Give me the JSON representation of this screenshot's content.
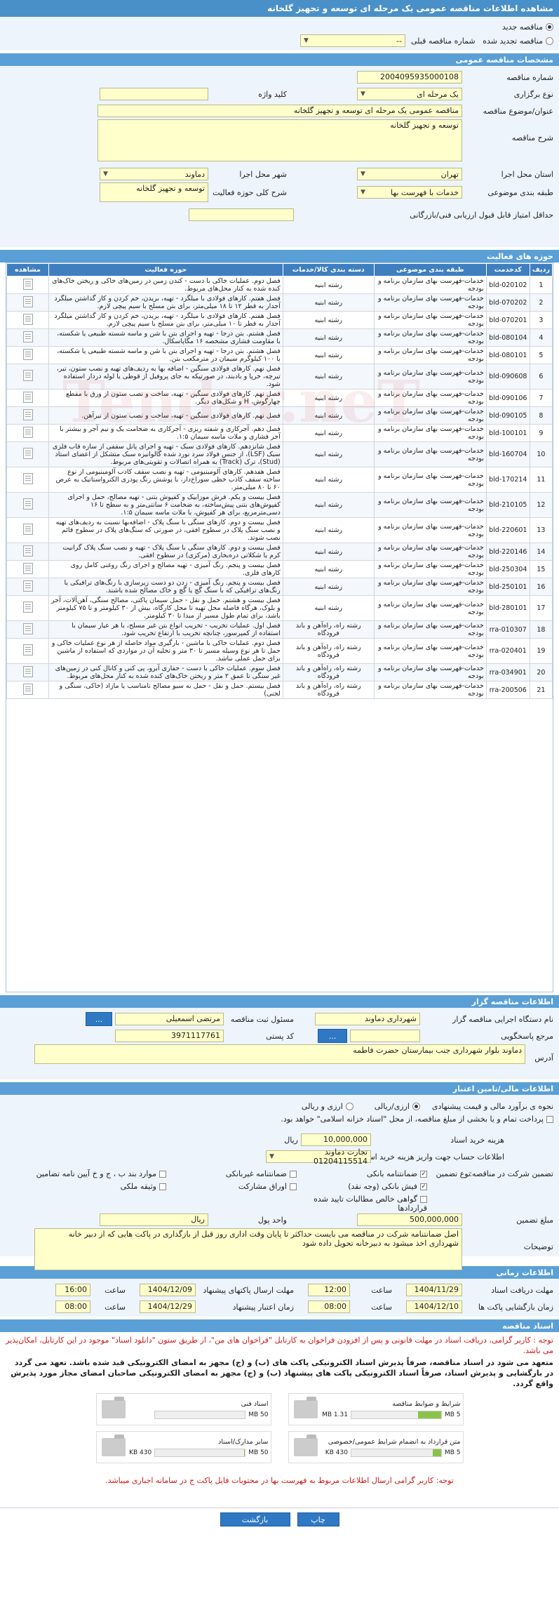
{
  "page_title": "مشاهده اطلاعات مناقصه عمومی یک مرحله ای توسعه و تجهیز گلخانه",
  "tender_type": {
    "new_label": "مناقصه جدید",
    "renew_label": "مناقصه تجدید شده",
    "prev_number_label": "شماره مناقصه قبلی",
    "prev_number_value": "--"
  },
  "specs": {
    "header": "مشخصات مناقصه عمومی",
    "number_label": "شماره مناقصه",
    "number_value": "2004095935000108",
    "hold_type_label": "نوع برگزاری",
    "hold_type_value": "یک مرحله ای",
    "keyword_label": "کلید واژه",
    "keyword_value": "",
    "subject_label": "عنوان/موضوع مناقصه",
    "subject_value": "مناقصه عمومی یک مرحله ای توسعه و تجهیز گلخانه",
    "description_label": "شرح مناقصه",
    "description_value": "توسعه و تجهیز گلخانه",
    "province_label": "استان محل اجرا",
    "province_value": "تهران",
    "city_label": "شهر محل اجرا",
    "city_value": "دماوند",
    "category_label": "طبقه بندی موضوعی",
    "category_value": "خدمات با فهرست بها",
    "activity_label": "شرح کلی حوزه فعالیت",
    "activity_value": "توسعه و تجهیز گلخانه",
    "min_score_label": "حداقل امتیاز قابل قبول ارزیابی فنی/بازرگانی",
    "min_score_value": ""
  },
  "activity_table": {
    "header": "حوزه های فعالیت",
    "columns": [
      "ردیف",
      "کدخدمت",
      "طبقه بندی موضوعی",
      "دسته بندی کالا/خدمات",
      "حوزه فعالیت",
      "مشاهده"
    ],
    "rows": [
      {
        "n": "1",
        "code": "bld-020102",
        "cat": "خدمات-فهرست بهای سازمان برنامه و بودجه",
        "group": "رشته ابنیه",
        "desc": "فصل دوم. عملیات خاکی با دست - کندن زمین در زمین‌های خاکی و ریختن خاک‌های کنده شده به کنار محل‌های مربوط."
      },
      {
        "n": "2",
        "code": "bld-070202",
        "cat": "خدمات-فهرست بهای سازمان برنامه و بودجه",
        "group": "رشته ابنیه",
        "desc": "فصل هفتم. کارهای فولادی با میلگرد - تهیه، بریدن، خم کردن و کار گذاشتن میلگرد آجدار به قطر ۱۲ تا ۱۸ میلی‌متر، برای بتن مسلح با سیم پیچی لازم."
      },
      {
        "n": "3",
        "code": "bld-070201",
        "cat": "خدمات-فهرست بهای سازمان برنامه و بودجه",
        "group": "رشته ابنیه",
        "desc": "فصل هفتم. کارهای فولادی با میلگرد - تهیه، بریدن، خم کردن و کار گذاشتن میلگرد آجدار به قطر تا ۱۰ میلی‌متر، برای بتن مسلح با سیم پیچی لازم."
      },
      {
        "n": "4",
        "code": "bld-080104",
        "cat": "خدمات-فهرست بهای سازمان برنامه و بودجه",
        "group": "رشته ابنیه",
        "desc": "فصل هشتم. بتن درجا - تهیه و اجرای بتن با شن و ماسه شسته طبیعی یا شکسته، با مقاومت فشاری مشخصه ۱۶ مگاپاسکال."
      },
      {
        "n": "5",
        "code": "bld-080101",
        "cat": "خدمات-فهرست بهای سازمان برنامه و بودجه",
        "group": "رشته ابنیه",
        "desc": "فصل هشتم. بتن درجا - تهیه و اجرای بتن با شن و ماسه شسته طبیعی یا شکسته، با ۱۰۰ کیلوگرم سیمان در مترمکعب بتن."
      },
      {
        "n": "6",
        "code": "bld-090608",
        "cat": "خدمات-فهرست بهای سازمان برنامه و بودجه",
        "group": "رشته ابنیه",
        "desc": "فصل نهم. کارهای فولادی سنگین - اضافه بها به ردیف‌های تهیه و نصب ستون، تیر، تیرچه، خرپا و بادبند، در صورتیکه به جای پروفیل از قوطی یا لوله دردار استفاده شود."
      },
      {
        "n": "7",
        "code": "bld-090106",
        "cat": "خدمات-فهرست بهای سازمان برنامه و بودجه",
        "group": "رشته ابنیه",
        "desc": "فصل نهم. کارهای فولادی سنگین - تهیه، ساخت و نصب ستون از ورق با مقطع چهارگوش، H و شکل‌های دیگر."
      },
      {
        "n": "8",
        "code": "bld-090105",
        "cat": "خدمات-فهرست بهای سازمان برنامه و بودجه",
        "group": "رشته ابنیه",
        "desc": "فصل نهم. کارهای فولادی سنگین - تهیه، ساخت و نصب ستون از تیرآهن."
      },
      {
        "n": "9",
        "code": "bld-100101",
        "cat": "خدمات-فهرست بهای سازمان برنامه و بودجه",
        "group": "رشته ابنیه",
        "desc": "فصل دهم. آجرکاری و شفته ریزی - آجرکاری به ضخامت یک و نیم آجر و بیشتر با آجر فشاری و ملات ماسه سیمان ۱:۵."
      },
      {
        "n": "10",
        "code": "bld-160704",
        "cat": "خدمات-فهرست بهای سازمان برنامه و بودجه",
        "group": "رشته ابنیه",
        "desc": "فصل شانزدهم. کارهای فولادی سبک - تهیه و اجرای پانل سقفی از سازه قاب فلزی سبک (LSF)، از جنس فولاد سرد نورد شده گالوانیزه سبک متشکل از اعضای استاد (Stud)، ترک (Track) به همراه اتصالات و تقویتی‌های مربوط."
      },
      {
        "n": "11",
        "code": "bld-170214",
        "cat": "خدمات-فهرست بهای سازمان برنامه و بودجه",
        "group": "رشته ابنیه",
        "desc": "فصل هفدهم. کارهای آلومینیومی - تهیه و نصب سقف کاذب آلومینیومی از نوع ساخته سقف کاذب خطی سوراخ‌دار، با پوشش رنگ پودری الکترواستاتیک به عرض ۶۰ تا ۸۰ میلی‌متر."
      },
      {
        "n": "12",
        "code": "bld-210105",
        "cat": "خدمات-فهرست بهای سازمان برنامه و بودجه",
        "group": "رشته ابنیه",
        "desc": "فصل بیست و یکم. فرش موزاییک و کفپوش بتنی - تهیه مصالح، حمل و اجرای کفپوش‌های بتنی پیش‌ساخته، به ضخامت ۶ سانتی‌متر و به سطح تا ۱۶ دسی‌مترمربع، برای هر کفپوش، با ملات ماسه سیمان ۱:۵."
      },
      {
        "n": "13",
        "code": "bld-220601",
        "cat": "خدمات-فهرست بهای سازمان برنامه و بودجه",
        "group": "رشته ابنیه",
        "desc": "فصل بیست و دوم. کارهای سنگی با سنگ پلاک - اضافه‌بها نسبت به ردیف‌های تهیه و نصب سنگ پلاک در سطوح افقی، در صورتی که سنگ‌های پلاک در سطوح قائم نصب شوند."
      },
      {
        "n": "14",
        "code": "bld-220146",
        "cat": "خدمات-فهرست بهای سازمان برنامه و بودجه",
        "group": "رشته ابنیه",
        "desc": "فصل بیست و دوم. کارهای سنگی با سنگ پلاک - تهیه و نصب سنگ پلاک گرانیت کرم یا شکلاتی دره‌بخاری (مرکزی) در سطوح افقی."
      },
      {
        "n": "15",
        "code": "bld-250304",
        "cat": "خدمات-فهرست بهای سازمان برنامه و بودجه",
        "group": "رشته ابنیه",
        "desc": "فصل بیست و پنجم. رنگ آمیزی - تهیه مصالح و اجرای رنگ روغنی کامل روی کارهای فلزی."
      },
      {
        "n": "16",
        "code": "bld-250101",
        "cat": "خدمات-فهرست بهای سازمان برنامه و بودجه",
        "group": "رشته ابنیه",
        "desc": "فصل بیست و پنجم. رنگ آمیزی - زدن دو دست زیرسازی با رنگ‌های ترافیکی یا رنگ‌های ترافیکی که با سنگ گچ یا گچ و خاک مصالح شده باشند."
      },
      {
        "n": "17",
        "code": "bld-280101",
        "cat": "خدمات-فهرست بهای سازمان برنامه و بودجه",
        "group": "رشته ابنیه",
        "desc": "فصل بیست و هشتم. حمل و نقل - حمل سیمان پاکتی، مصالح سنگی، آهن‌آلات، آجر و بلوک، هرگاه فاصله محل تهیه تا محل کارگاه، بیش از ۳۰ کیلومتر و تا ۷۵ کیلومتر باشد، برای تمام طول مسیر از مبدا تا ۳۰ کیلومتر."
      },
      {
        "n": "18",
        "code": "rra-010307",
        "cat": "خدمات-فهرست بهای سازمان برنامه و بودجه",
        "group": "رشته راه، راه‌آهن و باند فرودگاه",
        "desc": "فصل اول. عملیات تخریب - تخریب انواع بتن غیر مسلح، با هر عیار سیمان با استفاده از کمپرسور، چنانچه تخریب با ارتفاع تخریب شود."
      },
      {
        "n": "19",
        "code": "rra-020401",
        "cat": "خدمات-فهرست بهای سازمان برنامه و بودجه",
        "group": "رشته راه، راه‌آهن و باند فرودگاه",
        "desc": "فصل دوم. عملیات خاکی با ماشین - بارگیری مواد حاصله از هر نوع عملیات خاکی و حمل تا هر نوع وسیله مسیر تا ۳۰ متر و تخلیه آن در مواردی که استفاده از ماشین برای حمل عملی نباشد."
      },
      {
        "n": "20",
        "code": "rra-034901",
        "cat": "خدمات-فهرست بهای سازمان برنامه و بودجه",
        "group": "رشته راه، راه‌آهن و باند فرودگاه",
        "desc": "فصل سوم. عملیات خاکی با دست - حفاری آبرو، پی کنی و کانال کنی در زمین‌های غیر سنگی تا عمق ۲ متر و ریختن خاک‌های کنده شده به کنار محل‌های مربوط."
      },
      {
        "n": "21",
        "code": "rra-200506",
        "cat": "خدمات-فهرست بهای سازمان برنامه و بودجه",
        "group": "رشته راه، راه‌آهن و باند فرودگاه",
        "desc": "فصل بیستم. حمل و نقل - حمل به سیو مصالح نامناسب یا مازاد (خاکی، سنگی و لجنی)"
      }
    ]
  },
  "organizer": {
    "header": "اطلاعات مناقصه گزار",
    "org_label": "نام دستگاه اجرایی مناقصه گزار",
    "org_value": "شهرداری دماوند",
    "officer_label": "مسئول ثبت مناقصه",
    "officer_value": "مرتضی اسمعیلی",
    "ref_label": "مرجع پاسخگویی",
    "ref_value": "",
    "postal_label": "کد پستی",
    "postal_value": "3971117761",
    "address_label": "آدرس",
    "address_value": "دماوند بلوار شهرداری  جنب بیمارستان حضرت فاطمه",
    "more_btn": "...",
    "dots_btn": "..."
  },
  "financial": {
    "header": "اطلاعات مالی/تامین اعتبار",
    "estimate_label": "نحوه ی برآورد مالی و قیمت پیشنهادی",
    "estimate_opt1": "ارزی/ریالی",
    "estimate_opt2": "ارزی و ریالی",
    "treasury_note": "پرداخت تمام و یا بخشی از مبلغ مناقصه، از محل \"اسناد خزانه اسلامی\" خواهد بود.",
    "doc_cost_label": "هزینه خرید اسناد",
    "doc_cost_value": "10,000,000",
    "doc_cost_unit": "ریال",
    "account_label": "اطلاعات حساب جهت واریز هزینه خرید اسناد",
    "account_value": "تجارت دماوند 01204115514",
    "guarantee_label": "تضمین شرکت در مناقصه:",
    "guarantee_type_label": "نوع تضمین",
    "guarantees": [
      {
        "label": "ضمانتنامه بانکی",
        "checked": true
      },
      {
        "label": "ضمانتنامه غیربانکی",
        "checked": false
      },
      {
        "label": "موارد بند ب ، ج و خ آیین نامه تضامین",
        "checked": false
      },
      {
        "label": "فیش بانکی (وجه نقد)",
        "checked": true
      },
      {
        "label": "اوراق مشارکت",
        "checked": false
      },
      {
        "label": "وثیقه ملکی",
        "checked": false
      },
      {
        "label": "گواهی خالص مطالبات تایید شده قراردادها",
        "checked": false
      }
    ],
    "amount_label": "مبلغ تضمین",
    "amount_value": "500,000,000",
    "currency_label": "واحد پول",
    "currency_value": "ریال",
    "notes_label": "توضیحات",
    "notes_value": "اصل ضمانتنامه شرکت در مناقصه می بایست حداکثر تا پایان وقت اداری روز قبل از بازگذاری در پاکت هایی که از دبیر خانه شهرداری اخذ میشود به دبیرخانه تحویل داده شود"
  },
  "timing": {
    "header": "اطلاعات زمانی",
    "receive_deadline_label": "مهلت دریافت اسناد",
    "receive_deadline_date": "1404/11/29",
    "receive_deadline_time": "12:00",
    "submit_deadline_label": "مهلت ارسال پاکتهای پیشنهاد",
    "submit_deadline_date": "1404/12/09",
    "submit_deadline_time": "16:00",
    "opening_label": "زمان بازگشایی پاکت ها",
    "opening_date": "1404/12/10",
    "opening_time": "08:00",
    "validity_label": "زمان اعتبار پیشنهاد",
    "validity_date": "1404/12/29",
    "validity_time": "08:00",
    "time_label": "ساعت"
  },
  "documents": {
    "header": "اسناد مناقصه",
    "notice": "توجه : کاربر گرامی، دریافت اسناد در مهلت قانونی و پس از افزودن فراخوان به کارتابل \"فراخوان های من\"، از طریق ستون \"دانلود اسناد\" موجود در این کارتابل، امکان‌پذیر می باشد.",
    "commitment": "متعهد می شود در اسناد مناقصه، صرفاً پذیرش اسناد الکترونیکی پاکت های (ب) و (ج) مجهز به امضای الکترونیکی قید شده باشد. تعهد می گردد در بارگشایی و پذیرش اسناد، صرفاً اسناد الکترونیکی پاکت های پیشنهاد (ب) و (ج) مجهز به امضای الکترونیکی صاحبان امضای مجاز مورد پذیرش واقع گردد.",
    "files": [
      {
        "title": "شرایط و ضوابط مناقصه",
        "size": "1.31 MB",
        "max": "5 MB",
        "fill": 0.26
      },
      {
        "title": "اسناد فنی",
        "size": "",
        "max": "50 MB",
        "fill": 0
      },
      {
        "title": "متن قرارداد به انضمام شرایط عمومی/خصوصی",
        "size": "430 KB",
        "max": "5 MB",
        "fill": 0.09
      },
      {
        "title": "سایر مدارک/اسناد",
        "size": "430 KB",
        "max": "50 MB",
        "fill": 0.01
      }
    ],
    "bottom_note": "توجه: کاربر گرامی ارسال اطلاعات مربوط به فهرست بها در محتویات فایل پاکت ج در سامانه اجباری میباشد."
  },
  "actions": {
    "print": "چاپ",
    "back": "بازگشت"
  }
}
